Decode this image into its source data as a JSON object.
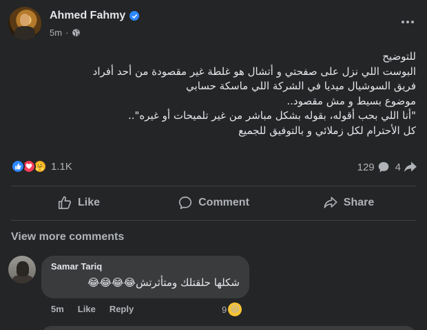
{
  "post": {
    "author": "Ahmed Fahmy",
    "time": "5m",
    "lines": [
      "للتوضيح",
      "البوست اللي نزل على صفحتي و أتشال هو غلطة غير مقصودة من أحد أفراد",
      "فريق السوشيال ميديا في الشركة اللي ماسكة حسابي",
      "موضوع بسيط و مش مقصود..",
      "\"أنا اللي بحب أقوله، بقوله بشكل مباشر من غير تلميحات أو غيره\"..",
      "كل الأحترام لكل زملائي و بالتوفيق للجميع"
    ],
    "reaction_count": "1.1K",
    "comment_count": "129",
    "share_count": "4"
  },
  "actions": {
    "like": "Like",
    "comment": "Comment",
    "share": "Share"
  },
  "comments": {
    "view_more": "View more comments",
    "items": [
      {
        "author": "Samar Tariq",
        "text": "شكلها حلقتلك ومتأثرتش😂😂😂😂",
        "time": "5m",
        "like": "Like",
        "reply": "Reply",
        "reaction_count": "9"
      }
    ]
  },
  "icons": {
    "verified": "verified-badge-icon",
    "privacy": "globe-icon",
    "more": "more-options-icon",
    "reactions": [
      "like-reaction-icon",
      "love-reaction-icon",
      "care-reaction-icon"
    ],
    "comment": "comment-bubble-icon",
    "share": "share-arrow-icon",
    "comment_reaction": "haha-reaction-icon"
  },
  "colors": {
    "background": "#242526",
    "bubble": "#3a3b3c",
    "accent": "#2d88ff",
    "love": "#f33e58"
  }
}
